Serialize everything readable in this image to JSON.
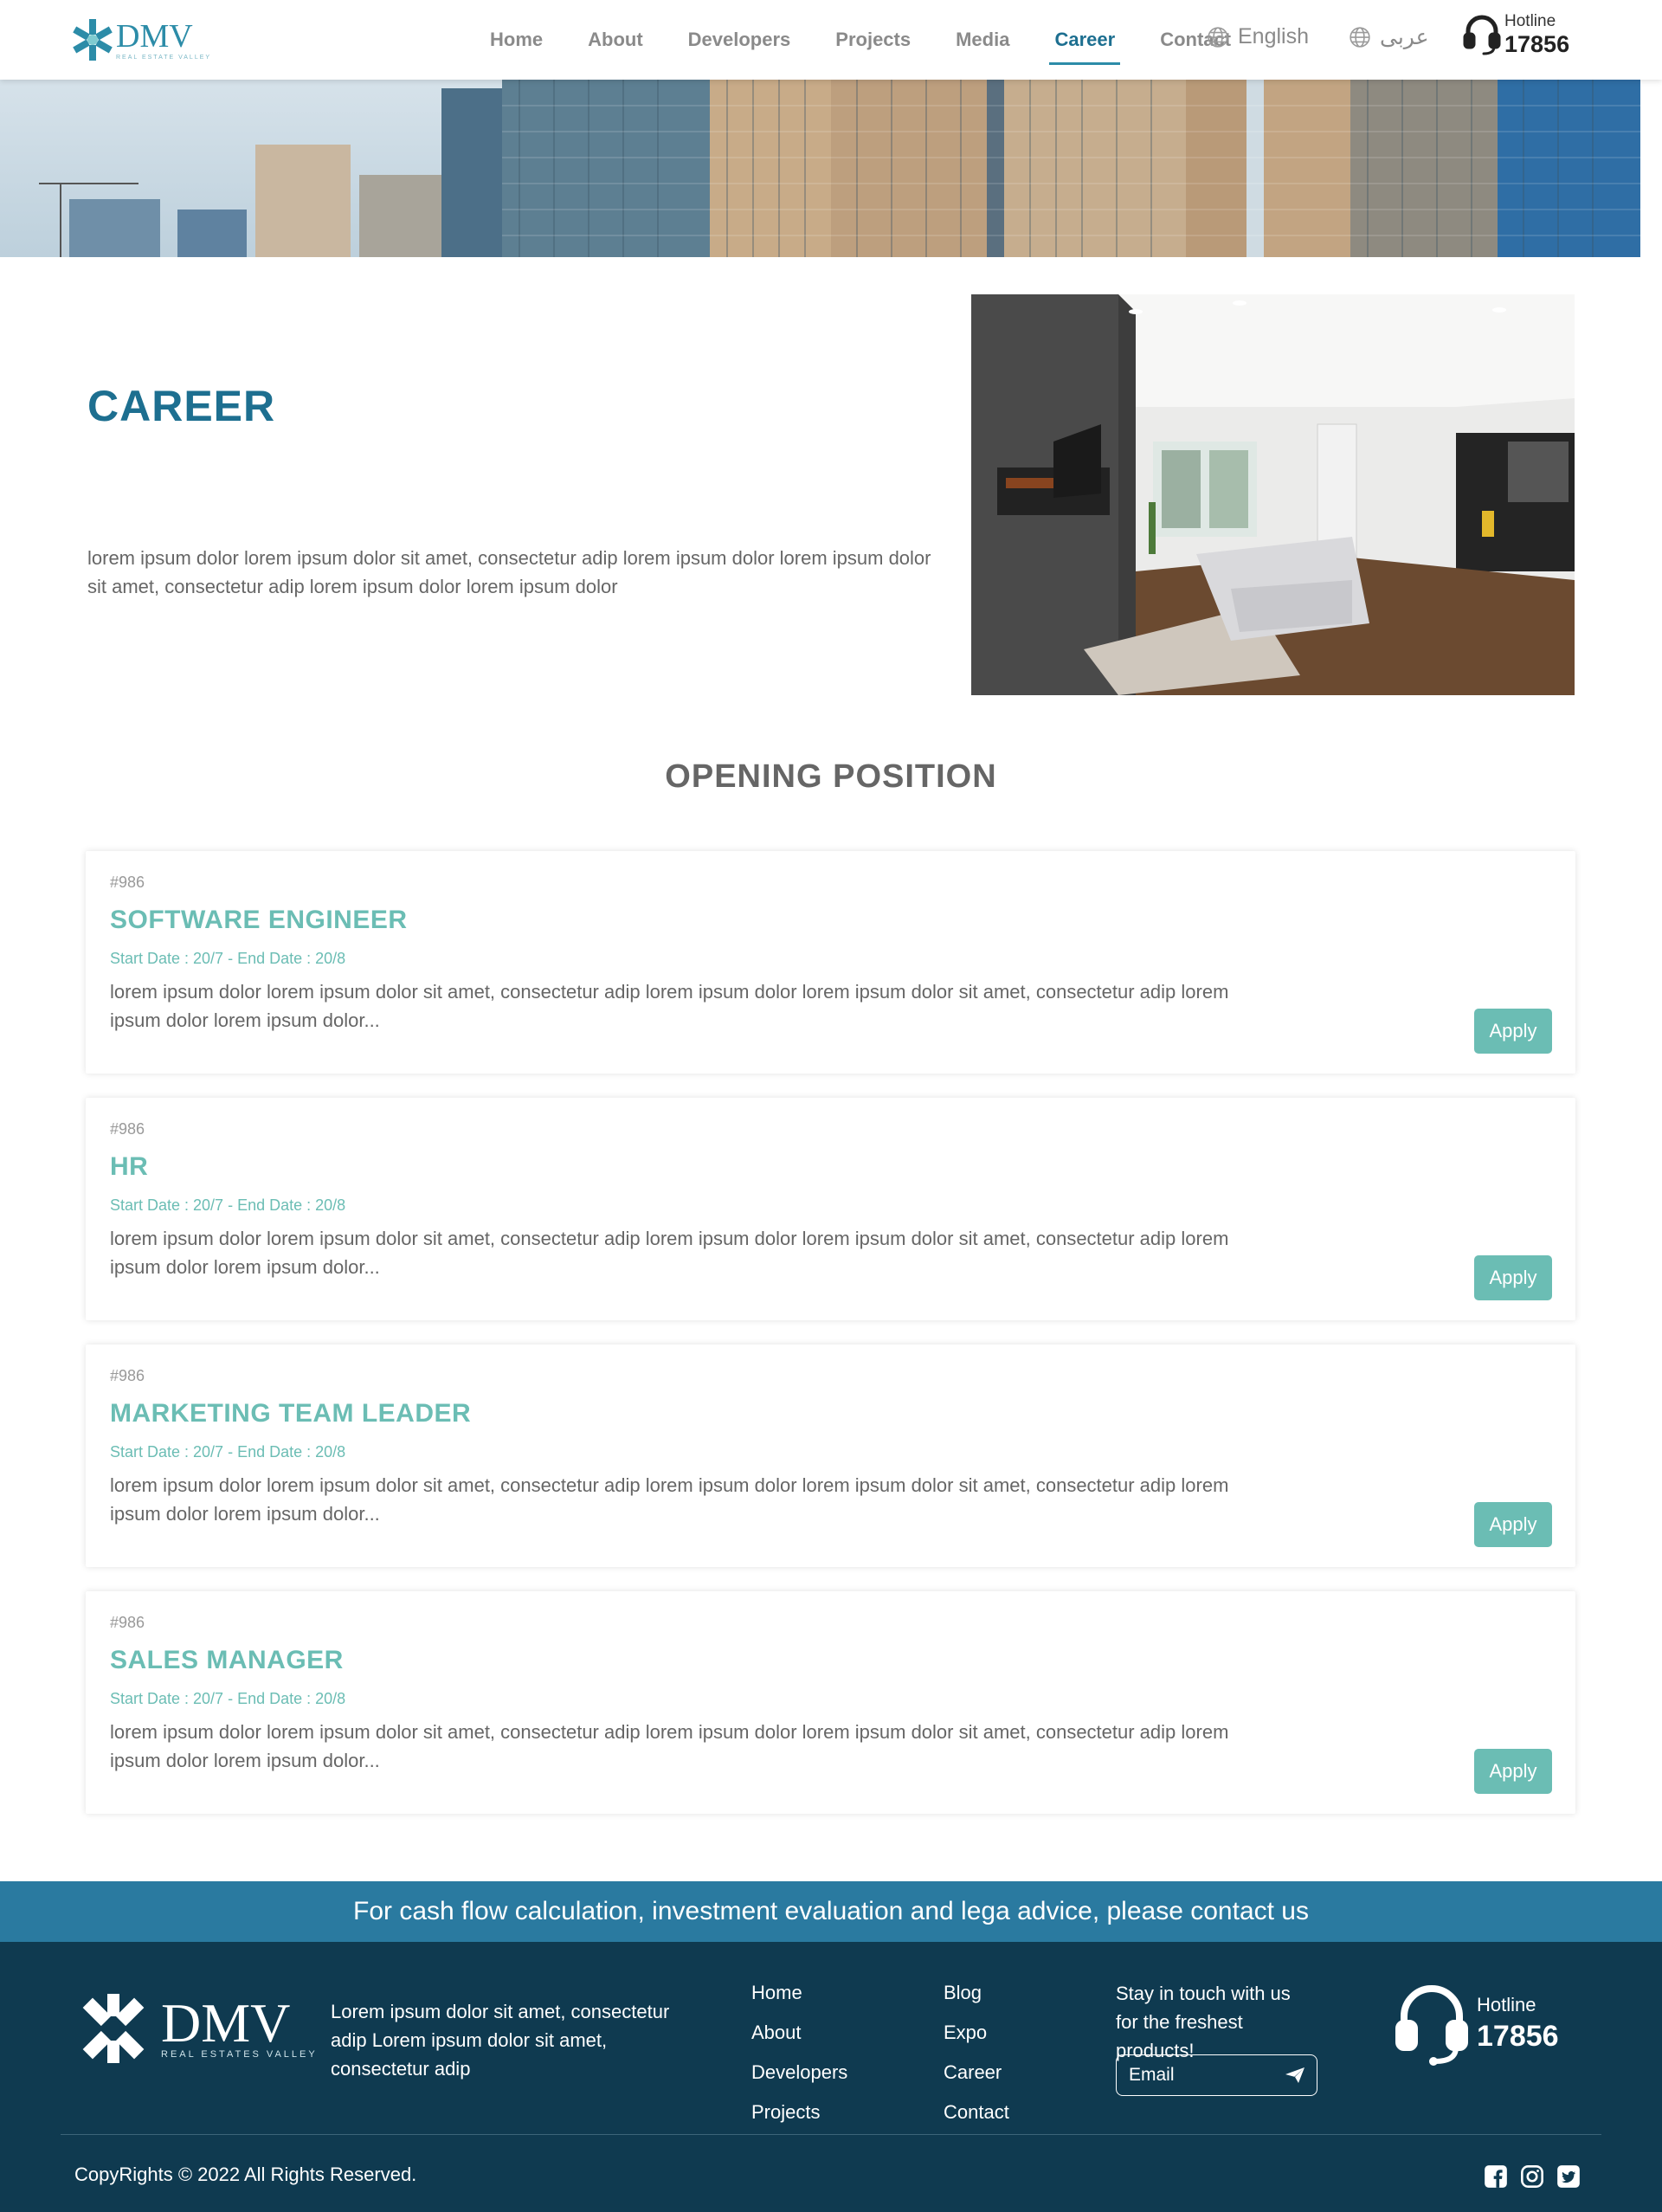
{
  "header": {
    "logo_text": "DMV",
    "logo_subtext": "REAL ESTATE VALLEY",
    "nav": [
      {
        "label": "Home",
        "active": false
      },
      {
        "label": "About",
        "active": false
      },
      {
        "label": "Developers",
        "active": false
      },
      {
        "label": "Projects",
        "active": false
      },
      {
        "label": "Media",
        "active": false
      },
      {
        "label": "Career",
        "active": true
      },
      {
        "label": "Contact",
        "active": false
      }
    ],
    "lang_english": "English",
    "lang_arabic": "عربى",
    "hotline_label": "Hotline",
    "hotline_number": "17856"
  },
  "career": {
    "title": "CAREER",
    "description": "lorem ipsum dolor lorem ipsum dolor sit amet, consectetur adip lorem ipsum dolor lorem ipsum dolor sit amet, consectetur adip lorem ipsum dolor lorem ipsum dolor"
  },
  "openings": {
    "title": "OPENING POSITION",
    "jobs": [
      {
        "code": "#986",
        "title": "SOFTWARE ENGINEER",
        "dates": "Start Date : 20/7 - End Date : 20/8",
        "description": "lorem ipsum dolor lorem ipsum dolor sit amet, consectetur adip lorem ipsum dolor lorem ipsum dolor sit amet, consectetur adip lorem ipsum dolor lorem ipsum dolor...",
        "apply_label": "Apply"
      },
      {
        "code": "#986",
        "title": "HR",
        "dates": "Start Date : 20/7 - End Date : 20/8",
        "description": "lorem ipsum dolor lorem ipsum dolor sit amet, consectetur adip lorem ipsum dolor lorem ipsum dolor sit amet, consectetur adip lorem ipsum dolor lorem ipsum dolor...",
        "apply_label": "Apply"
      },
      {
        "code": "#986",
        "title": "MARKETING TEAM LEADER",
        "dates": "Start Date : 20/7 - End Date : 20/8",
        "description": "lorem ipsum dolor lorem ipsum dolor sit amet, consectetur adip lorem ipsum dolor lorem ipsum dolor sit amet, consectetur adip lorem ipsum dolor lorem ipsum dolor...",
        "apply_label": "Apply"
      },
      {
        "code": "#986",
        "title": "SALES MANAGER",
        "dates": "Start Date : 20/7 - End Date : 20/8",
        "description": "lorem ipsum dolor lorem ipsum dolor sit amet, consectetur adip lorem ipsum dolor lorem ipsum dolor sit amet, consectetur adip lorem ipsum dolor lorem ipsum dolor...",
        "apply_label": "Apply"
      }
    ]
  },
  "contact_strip": {
    "text": "For cash flow calculation, investment evaluation and lega advice, please contact us"
  },
  "footer": {
    "logo_text": "DMV",
    "logo_subtext": "REAL ESTATES VALLEY",
    "description": "Lorem ipsum dolor sit amet, consectetur adip Lorem ipsum dolor sit amet, consectetur adip",
    "links_col1": [
      "Home",
      "About",
      "Developers",
      "Projects"
    ],
    "links_col2": [
      "Blog",
      "Expo",
      "Career",
      "Contact"
    ],
    "newsletter_text": "Stay in touch with us for the freshest products!",
    "email_placeholder": "Email",
    "hotline_label": "Hotline",
    "hotline_number": "17856",
    "copyright": "CopyRights © 2022 All Rights Reserved.",
    "social_icons": [
      "facebook-icon",
      "instagram-icon",
      "twitter-icon"
    ]
  },
  "colors": {
    "primary": "#1d6f90",
    "accent": "#6bbdb4",
    "strip": "#2a7aa0",
    "footer": "#0f3a50"
  }
}
